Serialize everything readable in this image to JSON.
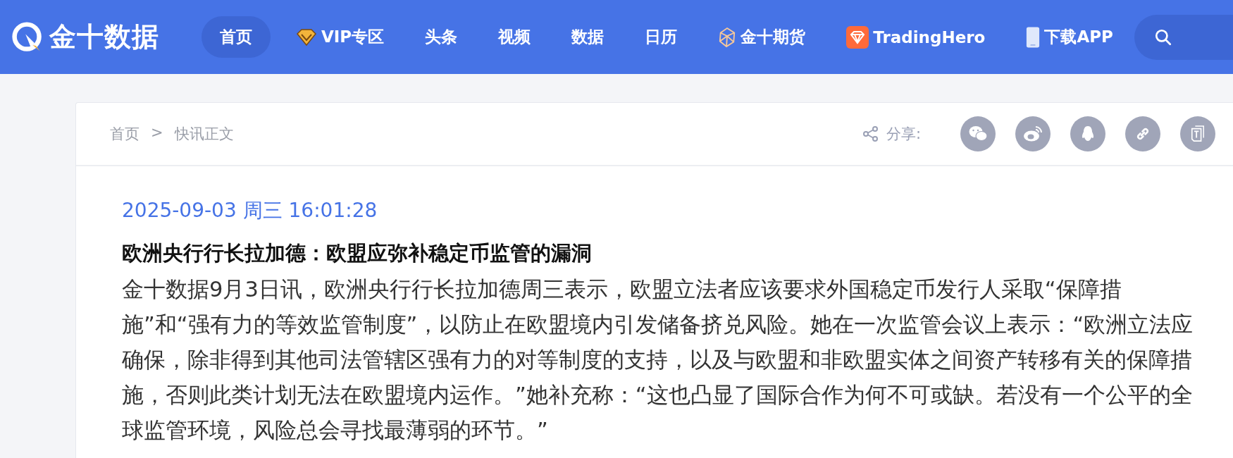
{
  "header": {
    "logo_text": "金十数据",
    "nav": [
      {
        "label": "首页",
        "selected": true
      },
      {
        "label": "VIP专区",
        "selected": false,
        "kind": "diamond"
      },
      {
        "label": "头条",
        "selected": false
      },
      {
        "label": "视频",
        "selected": false
      },
      {
        "label": "数据",
        "selected": false
      },
      {
        "label": "日历",
        "selected": false
      },
      {
        "label": "金十期货",
        "selected": false,
        "kind": "crystal"
      },
      {
        "label": "TradingHero",
        "selected": false,
        "kind": "badge"
      },
      {
        "label": "下载APP",
        "selected": false,
        "kind": "phone"
      }
    ]
  },
  "breadcrumb": [
    {
      "label": "首页"
    },
    {
      "label": "快讯正文"
    }
  ],
  "breadcrumb_separator": ">",
  "share": {
    "label": "分享:",
    "buttons": [
      {
        "kind": "wechat"
      },
      {
        "kind": "weibo"
      },
      {
        "kind": "qq"
      },
      {
        "kind": "link"
      },
      {
        "kind": "document"
      }
    ]
  },
  "article": {
    "datetime": "2025-09-03 周三 16:01:28",
    "title": "欧洲央行行长拉加德：欧盟应弥补稳定币监管的漏洞",
    "body": "金十数据9月3日讯，欧洲央行行长拉加德周三表示，欧盟立法者应该要求外国稳定币发行人采取“保障措施”和“强有力的等效监管制度”，以防止在欧盟境内引发储备挤兑风险。她在一次监管会议上表示：“欧洲立法应确保，除非得到其他司法管辖区强有力的对等制度的支持，以及与欧盟和非欧盟实体之间资产转移有关的保障措施，否则此类计划无法在欧盟境内运作。”她补充称：“这也凸显了国际合作为何不可或缺。若没有一个公平的全球监管环境，风险总会寻找最薄弱的环节。”"
  }
}
